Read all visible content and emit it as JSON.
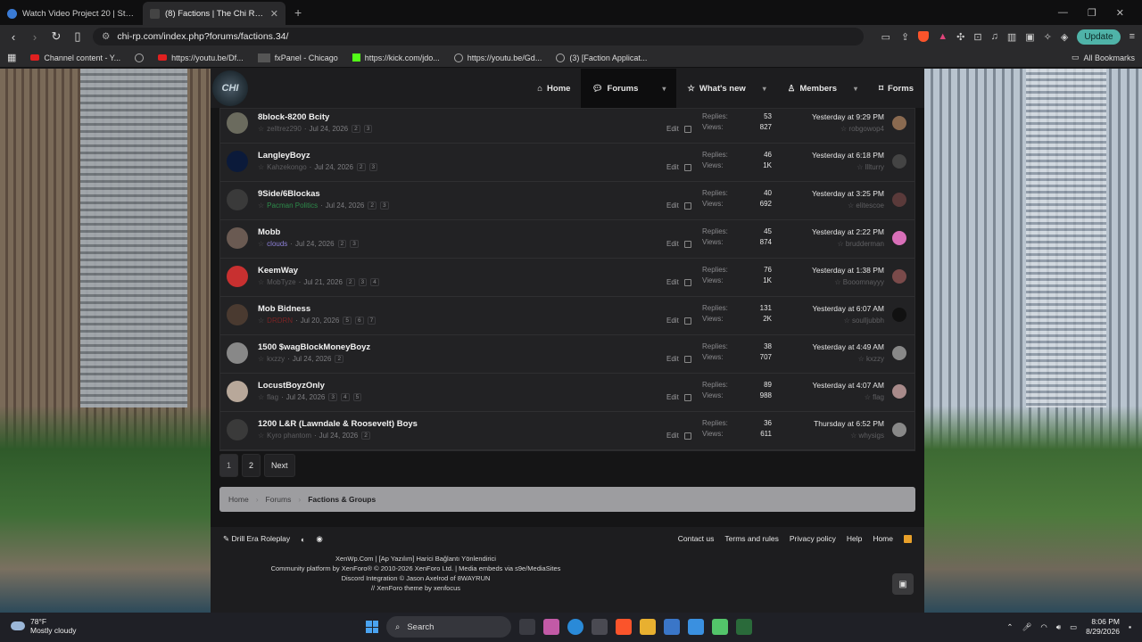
{
  "browser": {
    "tabs": [
      {
        "label": "Watch Video Project 20 | Streamable",
        "active": false
      },
      {
        "label": "(8) Factions | The Chi Roleplay",
        "active": true
      }
    ],
    "url": "chi-rp.com/index.php?forums/factions.34/",
    "update_label": "Update",
    "bookmarks": [
      {
        "label": "Channel content - Y...",
        "icon": "youtube-icon"
      },
      {
        "label": "",
        "icon": "globe-icon"
      },
      {
        "label": "https://youtu.be/Df...",
        "icon": "youtube-icon"
      },
      {
        "label": "fxPanel - Chicago",
        "icon": "image-icon"
      },
      {
        "label": "https://kick.com/jdo...",
        "icon": "kick-icon"
      },
      {
        "label": "https://youtu.be/Gd...",
        "icon": "globe-icon"
      },
      {
        "label": "(3) [Faction Applicat...",
        "icon": "globe-icon"
      }
    ],
    "all_bookmarks": "All Bookmarks"
  },
  "forum": {
    "logo_text": "CHI",
    "nav": [
      {
        "label": "Home",
        "icon": "home-icon",
        "active": false,
        "caret": false
      },
      {
        "label": "Forums",
        "icon": "chat-icon",
        "active": true,
        "caret": true
      },
      {
        "label": "What's new",
        "icon": "star-icon",
        "active": false,
        "caret": true
      },
      {
        "label": "Members",
        "icon": "user-icon",
        "active": false,
        "caret": true
      },
      {
        "label": "Forms",
        "icon": "tag-icon",
        "active": false,
        "caret": false
      }
    ],
    "replies_label": "Replies:",
    "views_label": "Views:",
    "edit_label": "Edit",
    "threads": [
      {
        "title": "8block-8200 Bcity",
        "author": "zelltrez290",
        "author_style": "",
        "date": "Jul 24, 2026",
        "pages": [
          "2",
          "3"
        ],
        "replies": "53",
        "views": "827",
        "last_time": "Yesterday at 9:29 PM",
        "last_user": "robgowop4",
        "av": "#6b6b5e",
        "lav": "#8a6a50"
      },
      {
        "title": "LangleyBoyz",
        "author": "Kahzekongo",
        "author_style": "",
        "date": "Jul 24, 2026",
        "pages": [
          "2",
          "3"
        ],
        "replies": "46",
        "views": "1K",
        "last_time": "Yesterday at 6:18 PM",
        "last_user": "lllturry",
        "av": "#0b1a3a",
        "lav": "#444"
      },
      {
        "title": "9Side/6Blockas",
        "author": "Pacman Politics",
        "author_style": "green",
        "date": "Jul 24, 2026",
        "pages": [
          "2",
          "3"
        ],
        "replies": "40",
        "views": "692",
        "last_time": "Yesterday at 3:25 PM",
        "last_user": "elitescoe",
        "av": "#3a3a3a",
        "lav": "#5a3a3a"
      },
      {
        "title": "Mobb",
        "author": "clouds",
        "author_style": "purple",
        "date": "Jul 24, 2026",
        "pages": [
          "2",
          "3"
        ],
        "replies": "45",
        "views": "874",
        "last_time": "Yesterday at 2:22 PM",
        "last_user": "brudderman",
        "av": "#6a5a52",
        "lav": "#d86fb8"
      },
      {
        "title": "KeemWay",
        "author": "MobTyze",
        "author_style": "",
        "date": "Jul 21, 2026",
        "pages": [
          "2",
          "3",
          "4"
        ],
        "replies": "76",
        "views": "1K",
        "last_time": "Yesterday at 1:38 PM",
        "last_user": "Booomnayyy",
        "av": "#c83030",
        "lav": "#7a4a4a"
      },
      {
        "title": "Mob Bidness",
        "author": "DRDRN",
        "author_style": "red",
        "date": "Jul 20, 2026",
        "pages": [
          "5",
          "6",
          "7"
        ],
        "replies": "131",
        "views": "2K",
        "last_time": "Yesterday at 6:07 AM",
        "last_user": "soulljubbh",
        "av": "#4a3a30",
        "lav": "#111"
      },
      {
        "title": "1500 $wagBlockMoneyBoyz",
        "author": "kxzzy",
        "author_style": "",
        "date": "Jul 24, 2026",
        "pages": [
          "2"
        ],
        "replies": "38",
        "views": "707",
        "last_time": "Yesterday at 4:49 AM",
        "last_user": "kxzzy",
        "av": "#888",
        "lav": "#888"
      },
      {
        "title": "LocustBoyzOnly",
        "author": "flag",
        "author_style": "",
        "date": "Jul 24, 2026",
        "pages": [
          "3",
          "4",
          "5"
        ],
        "replies": "89",
        "views": "988",
        "last_time": "Yesterday at 4:07 AM",
        "last_user": "flag",
        "av": "#b8a89a",
        "lav": "#a88a8a"
      },
      {
        "title": "1200 L&R (Lawndale & Roosevelt) Boys",
        "author": "Kyro phantom",
        "author_style": "",
        "date": "Jul 24, 2026",
        "pages": [
          "2"
        ],
        "replies": "36",
        "views": "611",
        "last_time": "Thursday at 6:52 PM",
        "last_user": "whysigs",
        "av": "#3a3a3a",
        "lav": "#888"
      }
    ],
    "pager": {
      "p1": "1",
      "p2": "2",
      "next": "Next"
    },
    "breadcrumb": {
      "home": "Home",
      "forums": "Forums",
      "current": "Factions & Groups"
    },
    "footer": {
      "style_name": "Drill Era Roleplay",
      "links": [
        "Contact us",
        "Terms and rules",
        "Privacy policy",
        "Help",
        "Home"
      ],
      "line1": "XenWp.Com | [Ap Yazılım] Harici Bağlantı Yönlendirici",
      "line2": "Community platform by XenForo® © 2010-2026 XenForo Ltd. | Media embeds via s9e/MediaSites",
      "line3": "Discord Integration © Jason Axelrod of 8WAYRUN",
      "line4": "XenForo theme by xenfocus"
    }
  },
  "taskbar": {
    "temp": "78°F",
    "weather": "Mostly cloudy",
    "search": "Search",
    "time": "8:06 PM",
    "date": "8/29/2026"
  }
}
